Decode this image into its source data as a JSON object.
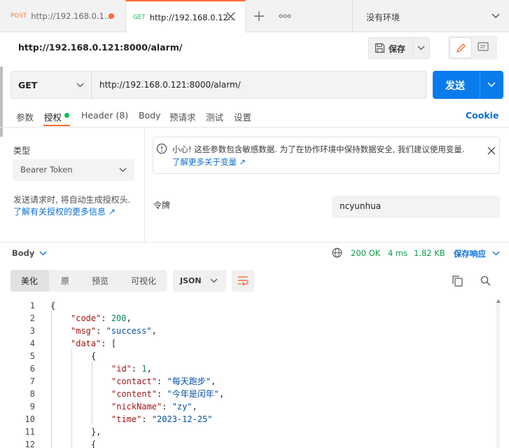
{
  "tabs": [
    {
      "method": "POST",
      "label": "http://192.168.0.1..."
    },
    {
      "method": "GET",
      "label": "http://192.168.0.12..."
    }
  ],
  "environment": {
    "label": "没有环境"
  },
  "request": {
    "title_url": "http://192.168.0.121:8000/alarm/",
    "save_label": "保存",
    "method": "GET",
    "url": "http://192.168.0.121:8000/alarm/",
    "send_label": "发送",
    "tabs": [
      "参数",
      "授权",
      "Header (8)",
      "Body",
      "预请求",
      "测试",
      "设置"
    ],
    "cookie_label": "Cookie"
  },
  "auth": {
    "type_label": "类型",
    "type_value": "Bearer Token",
    "help_text": "发送请求时, 将自动生成授权头.",
    "help_link": "了解有关授权的更多信息 ↗",
    "warning_text": "小心! 这些参数包含敏感数据. 为了在协作环境中保持数据安全, 我们建议使用变量.",
    "warning_link": "了解更多关于变量 ↗",
    "token_label": "令牌",
    "token_value": "ncyunhua"
  },
  "response": {
    "body_label": "Body",
    "status": "200 OK",
    "time": "4 ms",
    "size": "1.82 KB",
    "save_label": "保存响应",
    "view_tabs": [
      "美化",
      "原",
      "预览",
      "可视化"
    ],
    "format": "JSON",
    "code_lines": [
      {
        "num": "1",
        "indent": 0,
        "text": "{"
      },
      {
        "num": "2",
        "indent": 1,
        "key": "code",
        "value": "200",
        "vtype": "n",
        "trail": ","
      },
      {
        "num": "3",
        "indent": 1,
        "key": "msg",
        "value": "\"success\"",
        "vtype": "s",
        "trail": ","
      },
      {
        "num": "4",
        "indent": 1,
        "key": "data",
        "value": "[",
        "vtype": "p",
        "trail": ""
      },
      {
        "num": "5",
        "indent": 2,
        "text": "{"
      },
      {
        "num": "6",
        "indent": 3,
        "key": "id",
        "value": "1",
        "vtype": "n",
        "trail": ","
      },
      {
        "num": "7",
        "indent": 3,
        "key": "contact",
        "value": "\"每天跑步\"",
        "vtype": "s",
        "trail": ","
      },
      {
        "num": "8",
        "indent": 3,
        "key": "content",
        "value": "\"今年是闰年\"",
        "vtype": "s",
        "trail": ","
      },
      {
        "num": "9",
        "indent": 3,
        "key": "nickName",
        "value": "\"zy\"",
        "vtype": "s",
        "trail": ","
      },
      {
        "num": "10",
        "indent": 3,
        "key": "time",
        "value": "\"2023-12-25\"",
        "vtype": "s",
        "trail": ""
      },
      {
        "num": "11",
        "indent": 2,
        "text": "},"
      },
      {
        "num": "12",
        "indent": 2,
        "text": "{"
      }
    ]
  },
  "colors": {
    "accent": "#ff6c37",
    "primary": "#097bed",
    "success": "#0a9c48",
    "get": "#0cbb52",
    "post": "#ff7a2a"
  }
}
